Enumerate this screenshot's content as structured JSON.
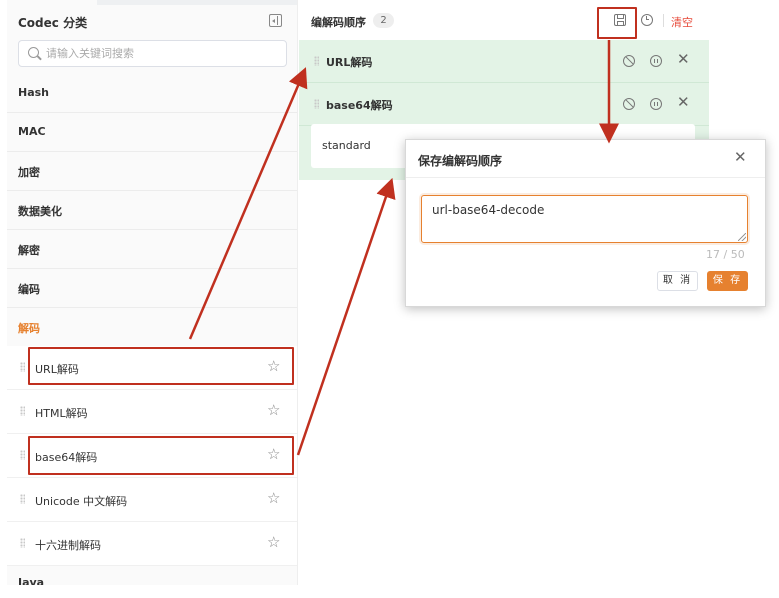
{
  "sidebar": {
    "title": "Codec 分类",
    "search_placeholder": "请输入关键词搜索",
    "categories": [
      {
        "label": "Hash"
      },
      {
        "label": "MAC"
      },
      {
        "label": "加密"
      },
      {
        "label": "数据美化"
      },
      {
        "label": "解密"
      },
      {
        "label": "编码"
      },
      {
        "label": "解码"
      }
    ],
    "sub_items": [
      {
        "label": "URL解码"
      },
      {
        "label": "HTML解码"
      },
      {
        "label": "base64解码"
      },
      {
        "label": "Unicode 中文解码"
      },
      {
        "label": "十六进制解码"
      }
    ],
    "next_category": "Java"
  },
  "main": {
    "title": "编解码顺序",
    "count": "2",
    "clear_label": "清空",
    "stack": [
      {
        "label": "URL解码"
      },
      {
        "label": "base64解码",
        "option": "standard"
      }
    ]
  },
  "modal": {
    "title": "保存编解码顺序",
    "input_value": "url-base64-decode",
    "char_count": "17 / 50",
    "cancel_label": "取 消",
    "save_label": "保 存"
  },
  "colors": {
    "accent": "#e6812f",
    "stack_bg": "#e3f3e6",
    "annotation": "#c0301f",
    "danger": "#e74c3c"
  },
  "icons": [
    "panel-collapse-icon",
    "search-icon",
    "drag-handle-icon",
    "star-icon",
    "save-icon",
    "clock-icon",
    "ban-icon",
    "pause-icon",
    "close-icon"
  ]
}
